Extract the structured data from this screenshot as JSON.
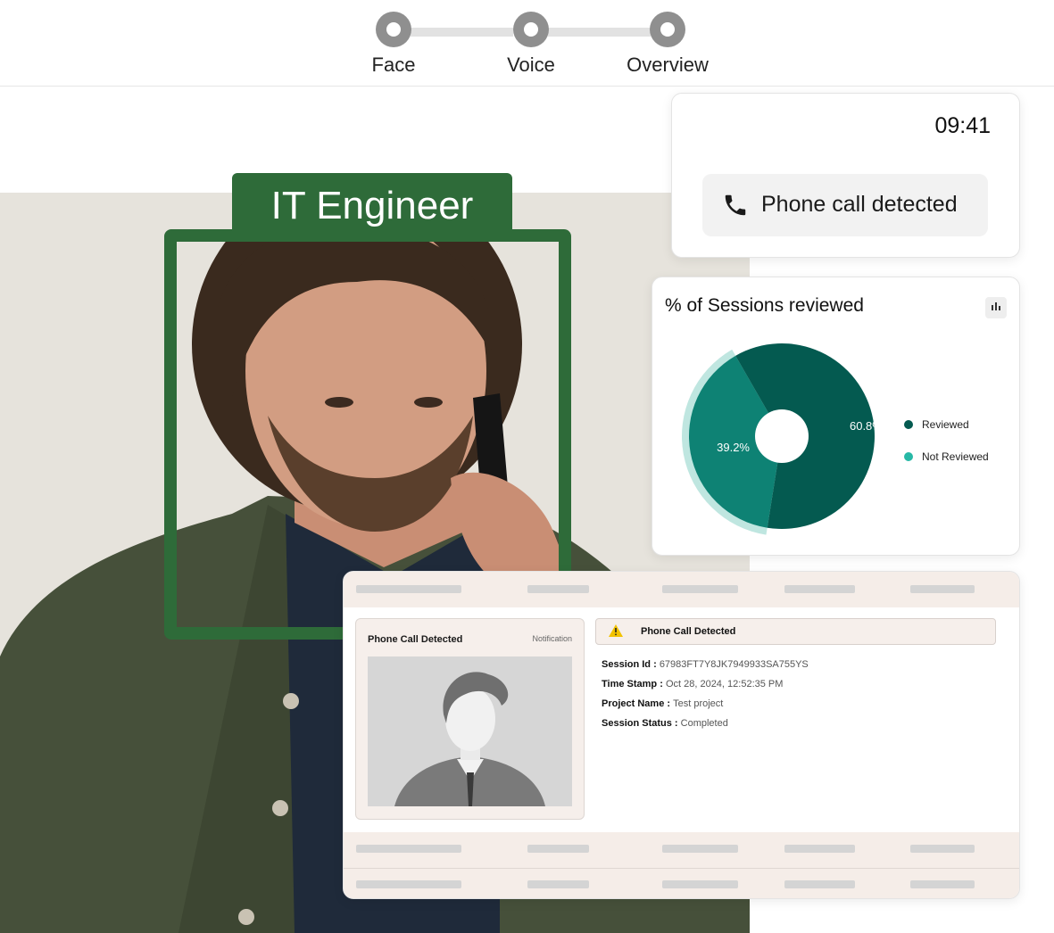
{
  "stepper": {
    "steps": [
      {
        "label": "Face"
      },
      {
        "label": "Voice"
      },
      {
        "label": "Overview"
      }
    ]
  },
  "profile": {
    "role": "IT Engineer"
  },
  "phone_card": {
    "time": "09:41",
    "alert_text": "Phone call detected",
    "icon": "phone-icon"
  },
  "sessions_chart": {
    "title": "% of Sessions reviewed",
    "menu_icon": "bar-chart-icon",
    "colors": {
      "reviewed": "#045a50",
      "not_reviewed": "#0e8274",
      "legend_not_reviewed": "#27b8a6"
    }
  },
  "chart_data": {
    "type": "pie",
    "title": "% of Sessions reviewed",
    "categories": [
      "Reviewed",
      "Not Reviewed"
    ],
    "values": [
      60.8,
      39.2
    ],
    "labels": [
      "60.8%",
      "39.2%"
    ],
    "donut": true,
    "legend": "right"
  },
  "notification": {
    "title": "Phone Call Detected",
    "tag": "Notification",
    "avatar_icon": "person-silhouette-icon"
  },
  "alert": {
    "title": "Phone Call Detected",
    "icon": "warning-icon"
  },
  "session": {
    "id_label": "Session Id :",
    "id_value": "67983FT7Y8JK7949933SA755YS",
    "time_label": "Time Stamp :",
    "time_value": "Oct 28, 2024, 12:52:35 PM",
    "project_label": "Project Name :",
    "project_value": "Test project",
    "status_label": "Session Status :",
    "status_value": "Completed"
  }
}
